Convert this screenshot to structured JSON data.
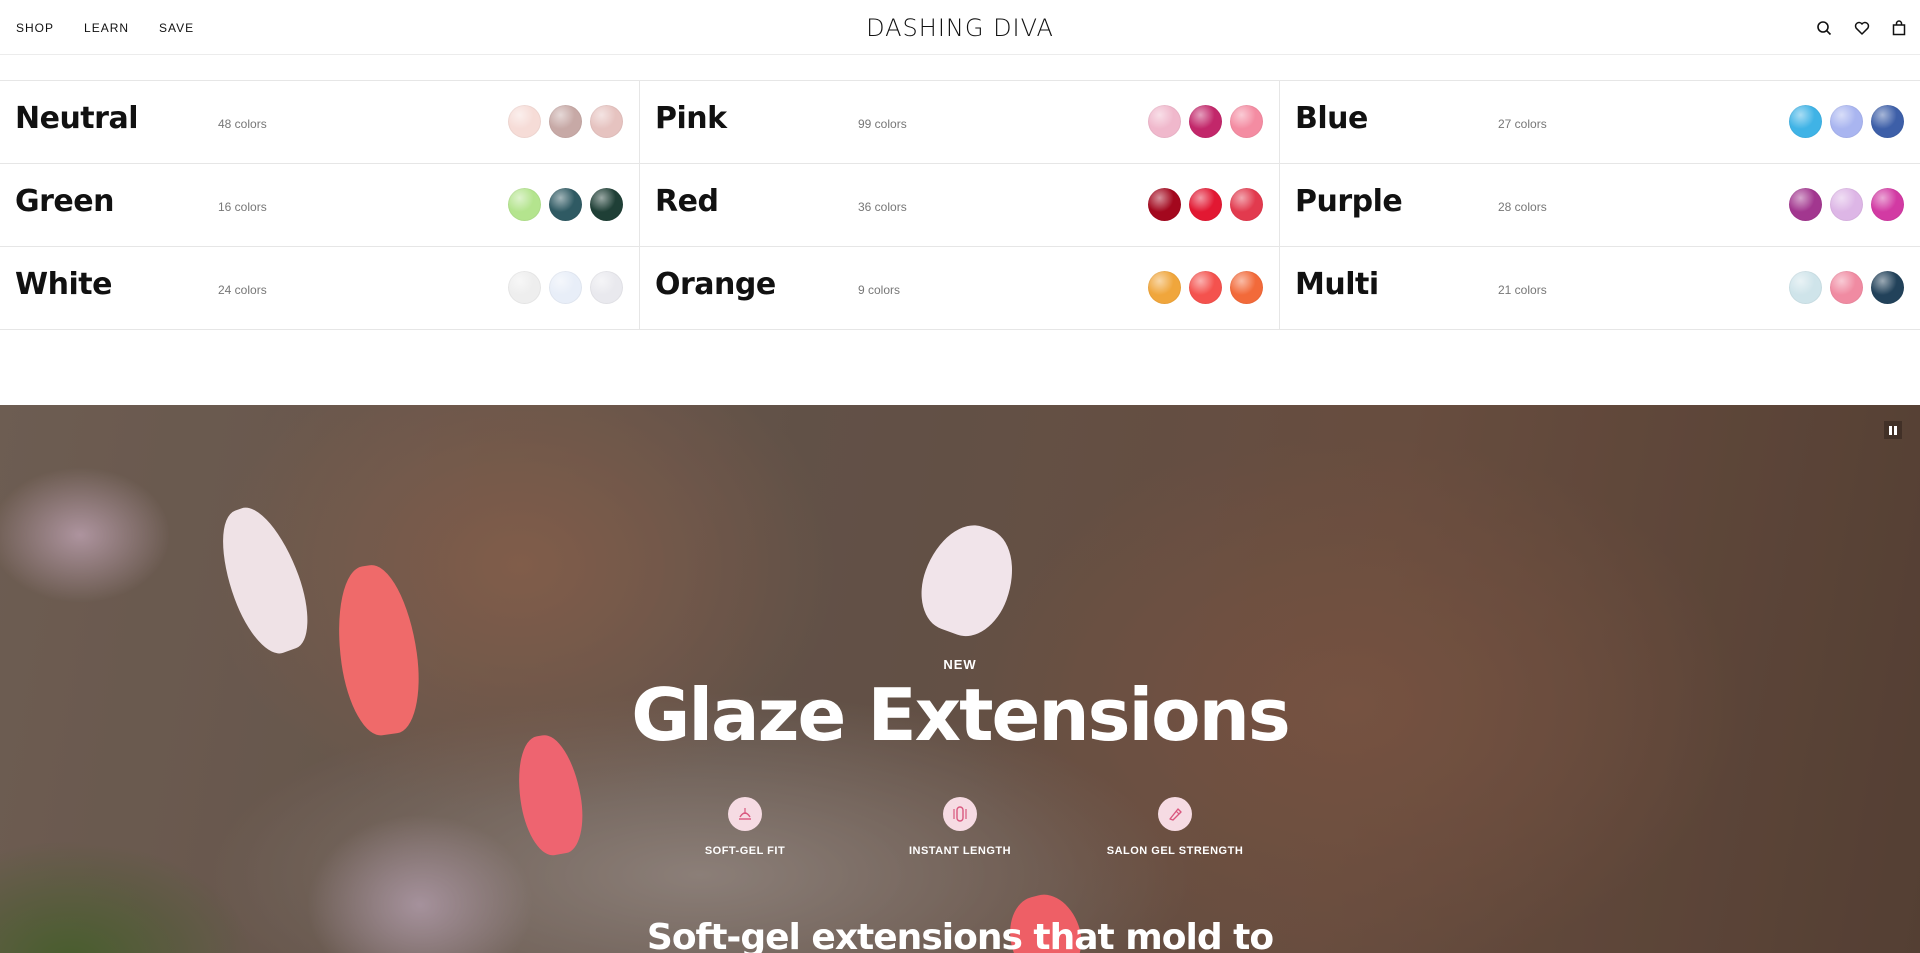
{
  "header": {
    "nav": [
      {
        "label": "SHOP"
      },
      {
        "label": "LEARN"
      },
      {
        "label": "SAVE"
      }
    ],
    "brand": "DASHING DIVA",
    "icons": [
      "search-icon",
      "heart-icon",
      "bag-icon"
    ]
  },
  "color_grid": [
    {
      "name": "Neutral",
      "count": "48 colors",
      "swatches": [
        "#f6dcd7",
        "#c7a9a6",
        "#e6c3c0"
      ]
    },
    {
      "name": "Pink",
      "count": "99 colors",
      "swatches": [
        "#f0b8cc",
        "#c2276a",
        "#f48ca2"
      ]
    },
    {
      "name": "Blue",
      "count": "27 colors",
      "swatches": [
        "#3fb3e6",
        "#a9b5f0",
        "#3d5fa8"
      ]
    },
    {
      "name": "Green",
      "count": "16 colors",
      "swatches": [
        "#b4e48e",
        "#2f5a63",
        "#1f3f36"
      ]
    },
    {
      "name": "Red",
      "count": "36 colors",
      "swatches": [
        "#a3081e",
        "#e21832",
        "#e23a4e"
      ]
    },
    {
      "name": "Purple",
      "count": "28 colors",
      "swatches": [
        "#a2378f",
        "#ddb6e6",
        "#d23aa3"
      ]
    },
    {
      "name": "White",
      "count": "24 colors",
      "swatches": [
        "#eeeeee",
        "#e8eef8",
        "#e9e9ee"
      ]
    },
    {
      "name": "Orange",
      "count": "9 colors",
      "swatches": [
        "#f0a63c",
        "#f4524e",
        "#f26a3a"
      ]
    },
    {
      "name": "Multi",
      "count": "21 colors",
      "swatches": [
        "#cfe4ea",
        "#f08ba2",
        "#22425a"
      ]
    }
  ],
  "hero": {
    "eyebrow": "NEW",
    "title": "Glaze Extensions",
    "features": [
      {
        "label": "SOFT-GEL FIT",
        "icon": "soft-gel-icon"
      },
      {
        "label": "INSTANT LENGTH",
        "icon": "nail-length-icon"
      },
      {
        "label": "SALON GEL STRENGTH",
        "icon": "gel-strength-icon"
      }
    ],
    "subtitle": "Soft-gel extensions that mold to",
    "pause_icon": "pause-icon"
  }
}
